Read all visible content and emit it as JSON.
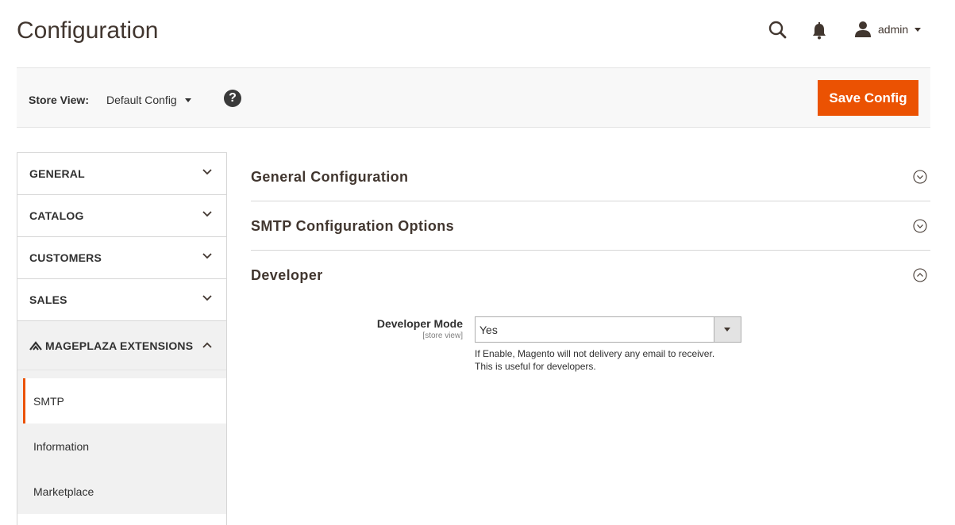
{
  "header": {
    "title": "Configuration",
    "user": "admin"
  },
  "store_bar": {
    "label": "Store View:",
    "value": "Default Config",
    "help": "?",
    "save_label": "Save Config"
  },
  "sidebar": {
    "tabs": [
      {
        "label": "GENERAL"
      },
      {
        "label": "CATALOG"
      },
      {
        "label": "CUSTOMERS"
      },
      {
        "label": "SALES"
      }
    ],
    "open_tab": {
      "label": "MAGEPLAZA EXTENSIONS",
      "items": [
        {
          "label": "SMTP",
          "active": true
        },
        {
          "label": "Information"
        },
        {
          "label": "Marketplace"
        }
      ]
    }
  },
  "main": {
    "sections": [
      {
        "title": "General Configuration",
        "expanded": false
      },
      {
        "title": "SMTP Configuration Options",
        "expanded": false
      },
      {
        "title": "Developer",
        "expanded": true
      }
    ],
    "field": {
      "label": "Developer Mode",
      "scope": "[store view]",
      "value": "Yes",
      "note_line1": "If Enable, Magento will not delivery any email to receiver.",
      "note_line2": "This is useful for developers."
    }
  },
  "colors": {
    "accent": "#eb5202",
    "text": "#41362f",
    "bar_bg": "#f8f8f8",
    "sidebar_open_bg": "#f1f1f1"
  }
}
